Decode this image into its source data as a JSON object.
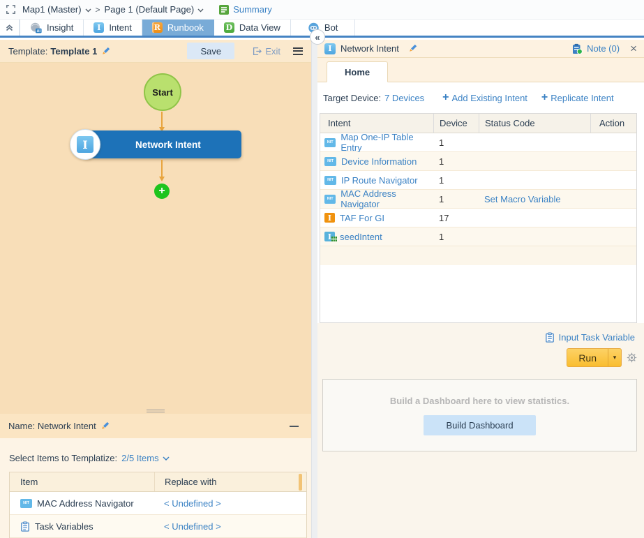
{
  "topbar": {
    "map_title": "Map1 (Master)",
    "crumb_sep": ">",
    "page_title": "Page 1  (Default Page)",
    "summary_label": "Summary"
  },
  "tabs": [
    {
      "label": "Insight"
    },
    {
      "label": "Intent"
    },
    {
      "label": "Runbook"
    },
    {
      "label": "Data View"
    },
    {
      "label": "Bot"
    }
  ],
  "badges": {
    "nit": "NIT",
    "i": "I",
    "r": "R",
    "d": "D",
    "ai": "AI"
  },
  "template_bar": {
    "prefix": "Template:",
    "name": "Template 1",
    "save_label": "Save",
    "exit_label": "Exit"
  },
  "canvas": {
    "start_label": "Start",
    "node_label": "Network Intent"
  },
  "bottom_panel": {
    "name_prefix": "Name:",
    "name_value": "Network Intent",
    "select_label": "Select Items to Templatize:",
    "select_value": "2/5 Items",
    "columns": [
      "Item",
      "Replace with"
    ],
    "rows": [
      {
        "item": "MAC Address Navigator",
        "replace": "< Undefined >"
      },
      {
        "item": "Task Variables",
        "replace": "< Undefined >"
      }
    ]
  },
  "right_panel": {
    "title": "Network Intent",
    "note_label": "Note (0)",
    "close_glyph": "×",
    "tab_home": "Home",
    "target_label": "Target Device:",
    "target_value": "7 Devices",
    "plus": "+",
    "add_existing": "Add Existing Intent",
    "replicate": "Replicate Intent",
    "columns": [
      "Intent",
      "Device",
      "Status Code",
      "Action"
    ],
    "rows": [
      {
        "intent": "Map One-IP Table Entry",
        "device": "1",
        "status": ""
      },
      {
        "intent": "Device Information",
        "device": "1",
        "status": ""
      },
      {
        "intent": "IP Route Navigator",
        "device": "1",
        "status": ""
      },
      {
        "intent": "MAC Address Navigator",
        "device": "1",
        "status": "Set Macro Variable"
      },
      {
        "intent": "TAF For GI",
        "device": "17",
        "status": ""
      },
      {
        "intent": "seedIntent",
        "device": "1",
        "status": ""
      }
    ],
    "input_task_variable": "Input Task Variable",
    "run_label": "Run",
    "dashboard_hint": "Build a Dashboard here to view statistics.",
    "build_dashboard": "Build Dashboard"
  },
  "colors": {
    "accent_blue": "#3b82c4",
    "node_blue": "#1d72b8",
    "canvas_peach": "#f8deb8",
    "run_yellow": "#fac344",
    "plus_green": "#1ec41e",
    "active_tab_blue": "#79abd7"
  }
}
